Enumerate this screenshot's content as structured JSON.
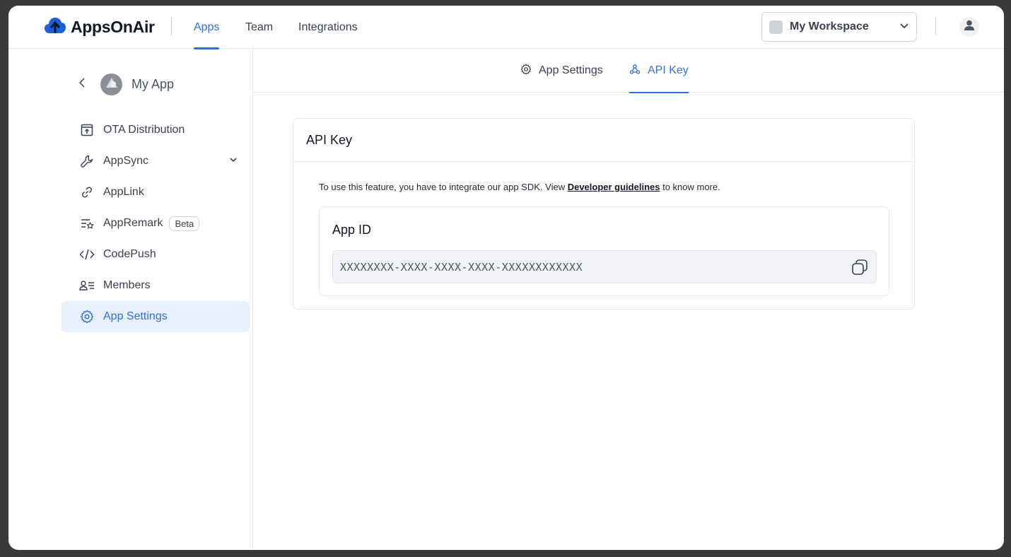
{
  "brand": {
    "name": "AppsOnAir",
    "accent": "#2f6fe0"
  },
  "topnav": {
    "tabs": [
      {
        "label": "Apps",
        "active": true
      },
      {
        "label": "Team",
        "active": false
      },
      {
        "label": "Integrations",
        "active": false
      }
    ]
  },
  "workspace": {
    "label": "My Workspace"
  },
  "sidebar": {
    "app_name": "My App",
    "items": [
      {
        "label": "OTA Distribution",
        "icon": "upload-box-icon"
      },
      {
        "label": "AppSync",
        "icon": "wrench-icon",
        "expandable": true
      },
      {
        "label": "AppLink",
        "icon": "link-icon"
      },
      {
        "label": "AppRemark",
        "icon": "list-star-icon",
        "badge": "Beta"
      },
      {
        "label": "CodePush",
        "icon": "code-icon"
      },
      {
        "label": "Members",
        "icon": "members-icon"
      },
      {
        "label": "App Settings",
        "icon": "gear-icon",
        "active": true
      }
    ]
  },
  "subtabs": [
    {
      "label": "App Settings",
      "icon": "gear-icon",
      "active": false
    },
    {
      "label": "API Key",
      "icon": "webhook-icon",
      "active": true
    }
  ],
  "card": {
    "title": "API Key",
    "desc_before": "To use this feature, you have to integrate our app SDK. View ",
    "desc_link": "Developer guidelines",
    "desc_after": " to know more.",
    "app_id_label": "App ID",
    "app_id_value": "XXXXXXXX-XXXX-XXXX-XXXX-XXXXXXXXXXXX"
  }
}
